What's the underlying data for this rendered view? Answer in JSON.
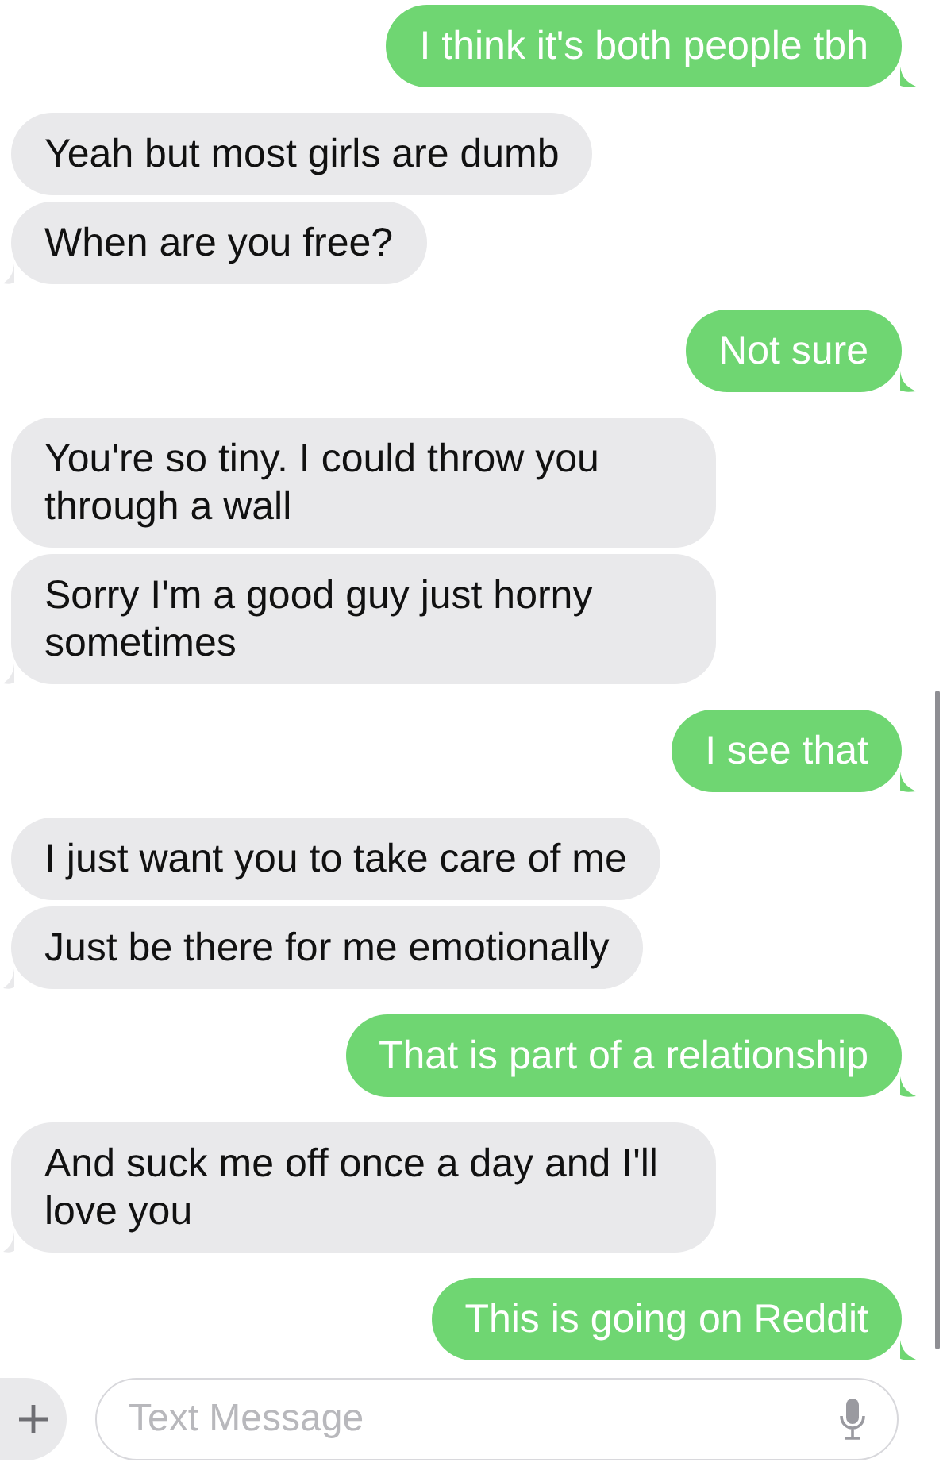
{
  "messages": [
    {
      "kind": "sent",
      "text": "I think it's both people tbh"
    },
    {
      "kind": "received",
      "text": "Yeah but most girls are dumb"
    },
    {
      "kind": "received",
      "text": "When are you free?"
    },
    {
      "kind": "sent",
      "text": "Not sure"
    },
    {
      "kind": "received",
      "text": "You're so tiny. I could throw you through a wall"
    },
    {
      "kind": "received",
      "text": "Sorry I'm a good guy just horny sometimes"
    },
    {
      "kind": "sent",
      "text": "I see that"
    },
    {
      "kind": "received",
      "text": "I just want you to take care of me"
    },
    {
      "kind": "received",
      "text": "Just be there for me emotionally"
    },
    {
      "kind": "sent",
      "text": "That is part of a relationship"
    },
    {
      "kind": "received",
      "text": "And suck me off once a day and I'll love you"
    },
    {
      "kind": "sent",
      "text": "This is going on Reddit"
    }
  ],
  "composer": {
    "placeholder": "Text Message"
  }
}
